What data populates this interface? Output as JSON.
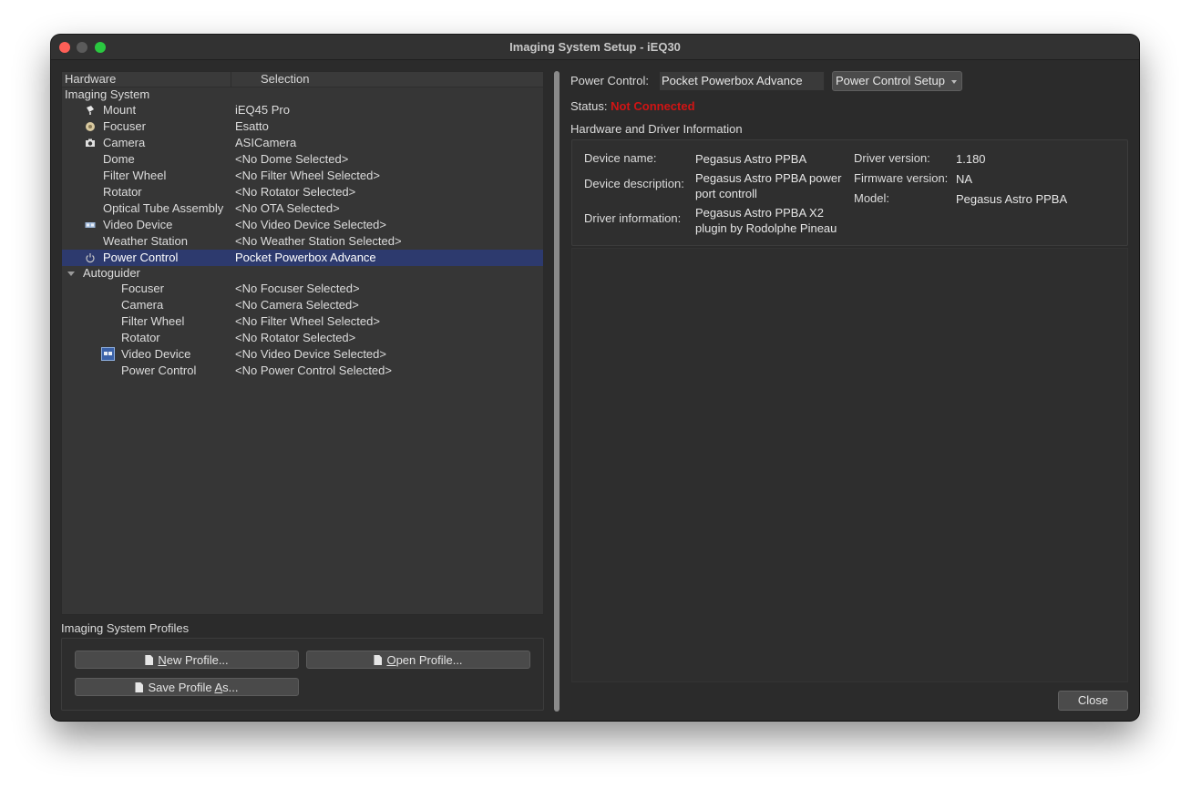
{
  "window": {
    "title": "Imaging System Setup - iEQ30"
  },
  "tree": {
    "headers": {
      "hardware": "Hardware",
      "selection": "Selection"
    },
    "groups": {
      "imaging": "Imaging System",
      "autoguider": "Autoguider"
    },
    "imaging_items": [
      {
        "name": "Mount",
        "value": "iEQ45 Pro",
        "icon": "mount-icon"
      },
      {
        "name": "Focuser",
        "value": "Esatto",
        "icon": "focuser-icon"
      },
      {
        "name": "Camera",
        "value": "ASICamera",
        "icon": "camera-icon"
      },
      {
        "name": "Dome",
        "value": "<No Dome Selected>",
        "icon": ""
      },
      {
        "name": "Filter Wheel",
        "value": "<No Filter Wheel Selected>",
        "icon": ""
      },
      {
        "name": "Rotator",
        "value": "<No Rotator Selected>",
        "icon": ""
      },
      {
        "name": "Optical Tube Assembly",
        "value": "<No OTA Selected>",
        "icon": ""
      },
      {
        "name": "Video Device",
        "value": "<No Video Device Selected>",
        "icon": "video-device-icon"
      },
      {
        "name": "Weather Station",
        "value": "<No Weather Station Selected>",
        "icon": ""
      },
      {
        "name": "Power Control",
        "value": "Pocket Powerbox Advance",
        "icon": "power-icon",
        "selected": true
      }
    ],
    "autoguider_items": [
      {
        "name": "Focuser",
        "value": "<No Focuser Selected>"
      },
      {
        "name": "Camera",
        "value": "<No Camera Selected>"
      },
      {
        "name": "Filter Wheel",
        "value": "<No Filter Wheel Selected>"
      },
      {
        "name": "Rotator",
        "value": "<No Rotator Selected>"
      },
      {
        "name": "Video Device",
        "value": "<No Video Device Selected>",
        "icon": "video-device-icon"
      },
      {
        "name": "Power Control",
        "value": "<No Power Control Selected>"
      }
    ]
  },
  "profiles": {
    "label": "Imaging System Profiles",
    "new": {
      "prefix": "",
      "accel": "N",
      "rest": "ew Profile..."
    },
    "open": {
      "prefix": "",
      "accel": "O",
      "rest": "pen Profile..."
    },
    "save": {
      "prefix": "Save Profile ",
      "accel": "A",
      "rest": "s..."
    }
  },
  "power_control": {
    "label": "Power Control:",
    "device": "Pocket Powerbox Advance",
    "setup_button": "Power Control Setup",
    "status_label": "Status:",
    "status_value": "Not Connected",
    "status_color": "#d11414"
  },
  "hardware_info": {
    "title": "Hardware and Driver Information",
    "device_name_label": "Device name:",
    "device_name": "Pegasus Astro PPBA",
    "device_description_label": "Device description:",
    "device_description": "Pegasus Astro PPBA power port controll",
    "driver_information_label": "Driver information:",
    "driver_information": "Pegasus Astro PPBA X2 plugin by Rodolphe Pineau",
    "driver_version_label": "Driver version:",
    "driver_version": "1.180",
    "firmware_version_label": "Firmware version:",
    "firmware_version": "NA",
    "model_label": "Model:",
    "model": "Pegasus Astro PPBA"
  },
  "close_button": "Close"
}
